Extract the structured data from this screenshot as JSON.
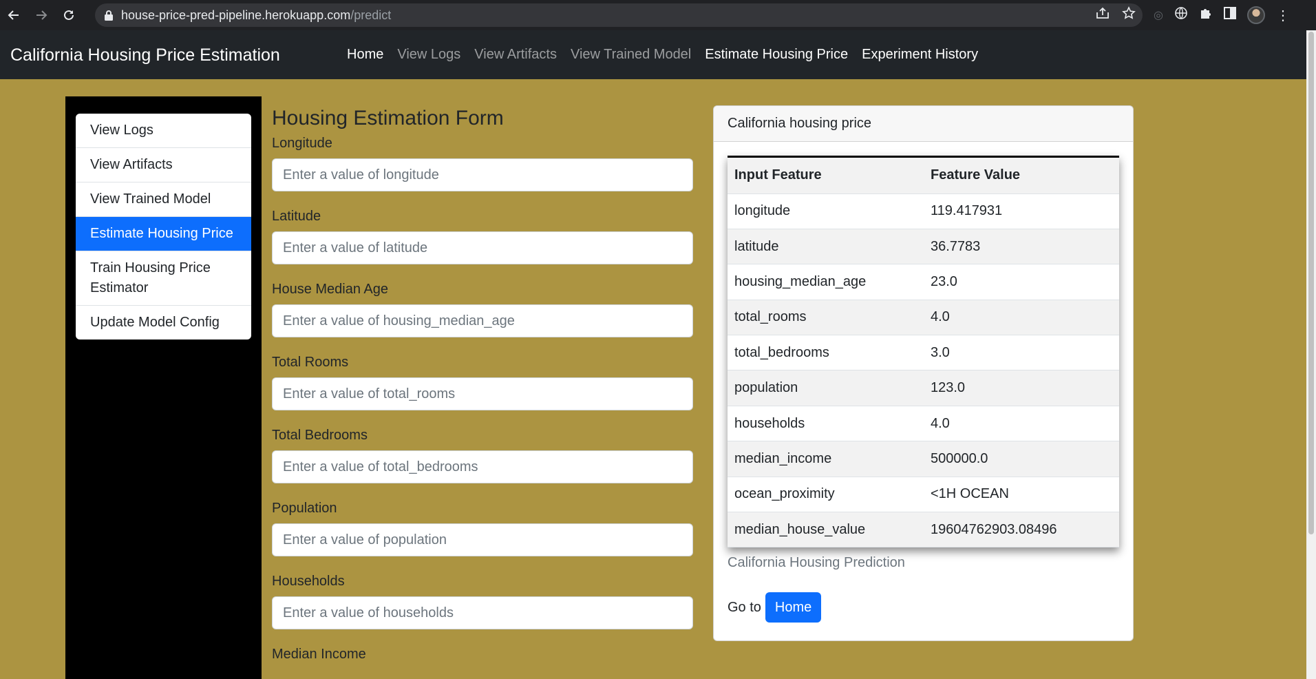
{
  "browser": {
    "url_host": "house-price-pred-pipeline.herokuapp.com",
    "url_path": "/predict"
  },
  "navbar": {
    "brand": "California Housing Price Estimation",
    "links": [
      "Home",
      "View Logs",
      "View Artifacts",
      "View Trained Model",
      "Estimate Housing Price",
      "Experiment History"
    ],
    "active_links": [
      "Home",
      "Estimate Housing Price",
      "Experiment History"
    ]
  },
  "sidebar": {
    "items": [
      "View Logs",
      "View Artifacts",
      "View Trained Model",
      "Estimate Housing Price",
      "Train Housing Price Estimator",
      "Update Model Config"
    ],
    "active": "Estimate Housing Price"
  },
  "form": {
    "title": "Housing Estimation Form",
    "fields": [
      {
        "label": "Longitude",
        "placeholder": "Enter a value of longitude",
        "value": ""
      },
      {
        "label": "Latitude",
        "placeholder": "Enter a value of latitude",
        "value": ""
      },
      {
        "label": "House Median Age",
        "placeholder": "Enter a value of housing_median_age",
        "value": ""
      },
      {
        "label": "Total Rooms",
        "placeholder": "Enter a value of total_rooms",
        "value": ""
      },
      {
        "label": "Total Bedrooms",
        "placeholder": "Enter a value of total_bedrooms",
        "value": ""
      },
      {
        "label": "Population",
        "placeholder": "Enter a value of population",
        "value": ""
      },
      {
        "label": "Households",
        "placeholder": "Enter a value of households",
        "value": ""
      },
      {
        "label": "Median Income",
        "placeholder": "",
        "value": ""
      }
    ]
  },
  "result_card": {
    "header": "California housing price",
    "columns": [
      "Input Feature",
      "Feature Value"
    ],
    "rows": [
      [
        "longitude",
        "119.417931"
      ],
      [
        "latitude",
        "36.7783"
      ],
      [
        "housing_median_age",
        "23.0"
      ],
      [
        "total_rooms",
        "4.0"
      ],
      [
        "total_bedrooms",
        "3.0"
      ],
      [
        "population",
        "123.0"
      ],
      [
        "households",
        "4.0"
      ],
      [
        "median_income",
        "500000.0"
      ],
      [
        "ocean_proximity",
        "<1H OCEAN"
      ],
      [
        "median_house_value",
        "19604762903.08496"
      ]
    ],
    "caption": "California Housing Prediction",
    "goto_text": "Go to",
    "home_button": "Home"
  },
  "colors": {
    "page_bg": "#ac9441",
    "navbar_bg": "#212529",
    "accent": "#0d6efd"
  }
}
